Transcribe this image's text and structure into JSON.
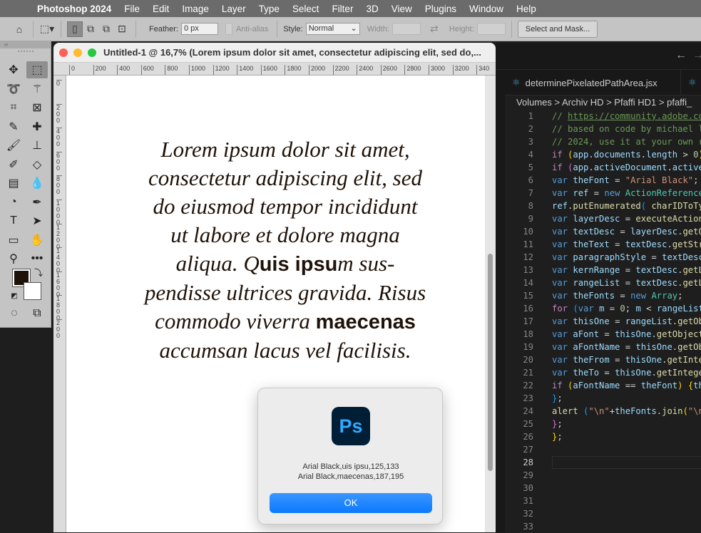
{
  "menubar": {
    "apple_icon": "apple-logo",
    "app": "Photoshop 2024",
    "items": [
      "File",
      "Edit",
      "Image",
      "Layer",
      "Type",
      "Select",
      "Filter",
      "3D",
      "View",
      "Plugins",
      "Window",
      "Help"
    ]
  },
  "options": {
    "feather_label": "Feather:",
    "feather_value": "0 px",
    "antialias_label": "Anti-alias",
    "style_label": "Style:",
    "style_value": "Normal",
    "width_label": "Width:",
    "height_label": "Height:",
    "select_mask": "Select and Mask..."
  },
  "toolbox": {
    "collapse": "‹‹",
    "tools": [
      "move",
      "rectangular-marquee",
      "lasso",
      "magic-wand",
      "crop",
      "frame",
      "eyedropper",
      "healing-brush",
      "brush",
      "clone-stamp",
      "history-brush",
      "eraser",
      "gradient",
      "blur",
      "dodge",
      "pen",
      "type",
      "path-selection",
      "rectangle",
      "hand",
      "zoom",
      "more-tools"
    ],
    "foreground": "#1f1208",
    "background": "#ffffff"
  },
  "document": {
    "title": "Untitled-1 @ 16,7% (Lorem ipsum dolor sit amet, consectetur adipiscing elit, sed do,...",
    "hruler": [
      "0",
      "200",
      "400",
      "600",
      "800",
      "1000",
      "1200",
      "1400",
      "1600",
      "1800",
      "2000",
      "2200",
      "2400",
      "2600",
      "2800",
      "3000",
      "3200",
      "340"
    ],
    "vruler": [
      "0",
      "200",
      "400",
      "600",
      "800",
      "1000",
      "1200",
      "1400",
      "1600",
      "1800",
      "200"
    ],
    "text": [
      [
        [
          "Lorem ipsum dolor sit amet,",
          0
        ]
      ],
      [
        [
          "consectetur adipiscing elit, sed",
          0
        ]
      ],
      [
        [
          "do eiusmod tempor incididunt",
          0
        ]
      ],
      [
        [
          "ut labore et dolore magna",
          0
        ]
      ],
      [
        [
          "aliqua. Q",
          0
        ],
        [
          "uis ipsu",
          1
        ],
        [
          "m sus-",
          0
        ]
      ],
      [
        [
          "pendisse ultrices gravida. Risus",
          0
        ]
      ],
      [
        [
          "commodo viverra ",
          0
        ],
        [
          "maecenas",
          1
        ]
      ],
      [
        [
          "accumsan lacus vel facilisis.",
          0
        ]
      ]
    ]
  },
  "editor": {
    "nav_back": "←",
    "nav_fwd": "→",
    "tab": "determinePixelatedPathArea.jsx",
    "crumb": "Volumes > Archiv HD > Pfaffi HD1 > pfaffi_",
    "current_line": 28,
    "lines": [
      [
        [
          "// ",
          "c-cm"
        ],
        [
          "https://community.adobe.co",
          "c-url"
        ]
      ],
      [
        [
          "// based on code by michael l",
          "c-cm"
        ]
      ],
      [
        [
          "// 2024, use it at your own r",
          "c-cm"
        ]
      ],
      [
        [
          "if ",
          "c-ctl"
        ],
        [
          "(",
          "c-b1"
        ],
        [
          "app",
          "c-var"
        ],
        [
          ".",
          "c-p"
        ],
        [
          "documents",
          "c-var"
        ],
        [
          ".",
          "c-p"
        ],
        [
          "length",
          "c-var"
        ],
        [
          " > ",
          "c-p"
        ],
        [
          "0",
          "c-num"
        ],
        [
          ")",
          "c-b1"
        ]
      ],
      [
        [
          "if ",
          "c-ctl"
        ],
        [
          "(",
          "c-b2"
        ],
        [
          "app",
          "c-var"
        ],
        [
          ".",
          "c-p"
        ],
        [
          "activeDocument",
          "c-var"
        ],
        [
          ".",
          "c-p"
        ],
        [
          "active",
          "c-var"
        ]
      ],
      [
        [
          "var ",
          "c-kw"
        ],
        [
          "theFont",
          "c-var"
        ],
        [
          " = ",
          "c-p"
        ],
        [
          "\"Arial Black\"",
          "c-str"
        ],
        [
          ";",
          "c-p"
        ]
      ],
      [
        [
          "var ",
          "c-kw"
        ],
        [
          "ref",
          "c-var"
        ],
        [
          " = ",
          "c-p"
        ],
        [
          "new ",
          "c-kw"
        ],
        [
          "ActionReference",
          "c-cls"
        ]
      ],
      [
        [
          "ref",
          "c-var"
        ],
        [
          ".",
          "c-p"
        ],
        [
          "putEnumerated",
          "c-fn"
        ],
        [
          "( ",
          "c-b3"
        ],
        [
          "charIDToTy",
          "c-fn"
        ]
      ],
      [
        [
          "var ",
          "c-kw"
        ],
        [
          "layerDesc",
          "c-var"
        ],
        [
          " = ",
          "c-p"
        ],
        [
          "executeAction",
          "c-fn"
        ]
      ],
      [
        [
          "var ",
          "c-kw"
        ],
        [
          "textDesc",
          "c-var"
        ],
        [
          " = ",
          "c-p"
        ],
        [
          "layerDesc",
          "c-var"
        ],
        [
          ".",
          "c-p"
        ],
        [
          "getO",
          "c-fn"
        ]
      ],
      [
        [
          "var ",
          "c-kw"
        ],
        [
          "theText",
          "c-var"
        ],
        [
          " = ",
          "c-p"
        ],
        [
          "textDesc",
          "c-var"
        ],
        [
          ".",
          "c-p"
        ],
        [
          "getStr",
          "c-fn"
        ]
      ],
      [
        [
          "var ",
          "c-kw"
        ],
        [
          "paragraphStyle",
          "c-var"
        ],
        [
          " = ",
          "c-p"
        ],
        [
          "textDesc",
          "c-var"
        ]
      ],
      [
        [
          "var ",
          "c-kw"
        ],
        [
          "kernRange",
          "c-var"
        ],
        [
          " = ",
          "c-p"
        ],
        [
          "textDesc",
          "c-var"
        ],
        [
          ".",
          "c-p"
        ],
        [
          "getL",
          "c-fn"
        ]
      ],
      [
        [
          "var ",
          "c-kw"
        ],
        [
          "rangeList",
          "c-var"
        ],
        [
          " = ",
          "c-p"
        ],
        [
          "textDesc",
          "c-var"
        ],
        [
          ".",
          "c-p"
        ],
        [
          "getL",
          "c-fn"
        ]
      ],
      [
        [
          "var ",
          "c-kw"
        ],
        [
          "theFonts",
          "c-var"
        ],
        [
          " = ",
          "c-p"
        ],
        [
          "new ",
          "c-kw"
        ],
        [
          "Array",
          "c-cls"
        ],
        [
          ";",
          "c-p"
        ]
      ],
      [
        [
          "for ",
          "c-ctl"
        ],
        [
          "(",
          "c-b3"
        ],
        [
          "var ",
          "c-kw"
        ],
        [
          "m",
          "c-var"
        ],
        [
          " = ",
          "c-p"
        ],
        [
          "0",
          "c-num"
        ],
        [
          "; ",
          "c-p"
        ],
        [
          "m",
          "c-var"
        ],
        [
          " < ",
          "c-p"
        ],
        [
          "rangeList",
          "c-var"
        ]
      ],
      [
        [
          "var ",
          "c-kw"
        ],
        [
          "thisOne",
          "c-var"
        ],
        [
          " = ",
          "c-p"
        ],
        [
          "rangeList",
          "c-var"
        ],
        [
          ".",
          "c-p"
        ],
        [
          "getOb",
          "c-fn"
        ]
      ],
      [
        [
          "var ",
          "c-kw"
        ],
        [
          "aFont",
          "c-var"
        ],
        [
          " = ",
          "c-p"
        ],
        [
          "thisOne",
          "c-var"
        ],
        [
          ".",
          "c-p"
        ],
        [
          "getObject",
          "c-fn"
        ]
      ],
      [
        [
          "var ",
          "c-kw"
        ],
        [
          "aFontName",
          "c-var"
        ],
        [
          " = ",
          "c-p"
        ],
        [
          "thisOne",
          "c-var"
        ],
        [
          ".",
          "c-p"
        ],
        [
          "getOb",
          "c-fn"
        ]
      ],
      [
        [
          "var ",
          "c-kw"
        ],
        [
          "theFrom",
          "c-var"
        ],
        [
          " = ",
          "c-p"
        ],
        [
          "thisOne",
          "c-var"
        ],
        [
          ".",
          "c-p"
        ],
        [
          "getInte",
          "c-fn"
        ]
      ],
      [
        [
          "var ",
          "c-kw"
        ],
        [
          "theTo",
          "c-var"
        ],
        [
          " = ",
          "c-p"
        ],
        [
          "thisOne",
          "c-var"
        ],
        [
          ".",
          "c-p"
        ],
        [
          "getIntege",
          "c-fn"
        ]
      ],
      [
        [
          "if ",
          "c-ctl"
        ],
        [
          "(",
          "c-b1"
        ],
        [
          "aFontName",
          "c-var"
        ],
        [
          " == ",
          "c-p"
        ],
        [
          "theFont",
          "c-var"
        ],
        [
          ") ",
          "c-b1"
        ],
        [
          "{",
          "c-b1"
        ],
        [
          "th",
          "c-var"
        ]
      ],
      [
        [
          "}",
          "c-b3"
        ],
        [
          ";",
          "c-p"
        ]
      ],
      [
        [
          "alert ",
          "c-fn"
        ],
        [
          "(",
          "c-b3"
        ],
        [
          "\"\\n\"",
          "c-str"
        ],
        [
          "+",
          "c-p"
        ],
        [
          "theFonts",
          "c-var"
        ],
        [
          ".",
          "c-p"
        ],
        [
          "join",
          "c-fn"
        ],
        [
          "(",
          "c-b1"
        ],
        [
          "\"\\n",
          "c-str"
        ]
      ],
      [
        [
          "}",
          "c-b2"
        ],
        [
          ";",
          "c-p"
        ]
      ],
      [
        [
          "}",
          "c-b1"
        ],
        [
          ";",
          "c-p"
        ]
      ],
      [],
      [],
      [],
      [],
      [],
      [],
      []
    ]
  },
  "dialog": {
    "icon_text": "Ps",
    "lines": [
      "Arial Black,uis ipsu,125,133",
      "Arial Black,maecenas,187,195"
    ],
    "ok": "OK"
  }
}
